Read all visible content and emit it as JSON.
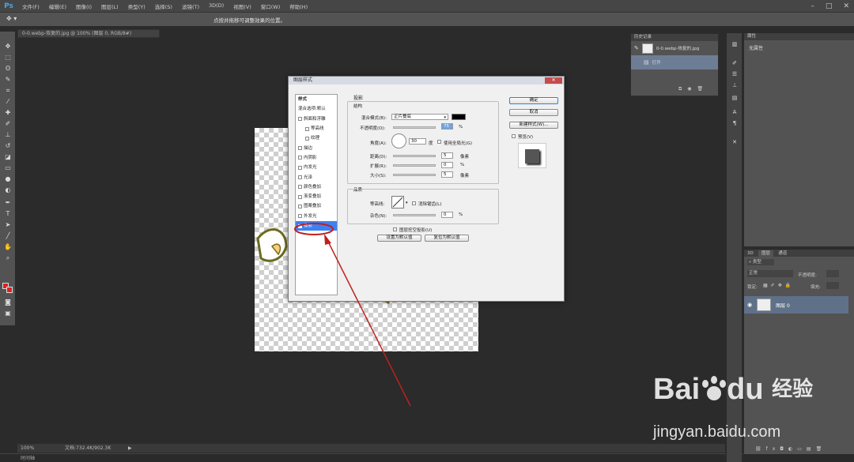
{
  "app": {
    "logo": "Ps"
  },
  "menu": [
    "文件(F)",
    "编辑(E)",
    "图像(I)",
    "图层(L)",
    "类型(Y)",
    "选择(S)",
    "滤镜(T)",
    "3D(D)",
    "视图(V)",
    "窗口(W)",
    "帮助(H)"
  ],
  "window_controls": [
    "–",
    "□",
    "✕"
  ],
  "options_bar": {
    "hint": "点按并拖移可调整效果的位置。"
  },
  "document": {
    "tab_title": "0-0.webp-恢复的.jpg @ 100% (图层 0, RGB/8#)"
  },
  "status": {
    "zoom": "100%",
    "doc_info": "文档:732.4K/902.3K",
    "bottom_label": "时间轴"
  },
  "history": {
    "tab": "历史记录",
    "items": [
      {
        "label": "0-0.webp-恢复的.jpg"
      },
      {
        "label": "打开"
      }
    ]
  },
  "properties": {
    "tab": "属性",
    "empty_text": "无属性"
  },
  "layers_panel": {
    "tabs": [
      "3D",
      "图层",
      "通道"
    ],
    "filter_label": "类型",
    "blend_mode": "正常",
    "opacity_label": "不透明度:",
    "lock_label": "锁定:",
    "fill_label": "填充:",
    "layer_name": "图层 0"
  },
  "dialog": {
    "title": "图层样式",
    "styles_header": "样式",
    "styles": [
      {
        "label": "混合选项:默认",
        "checkbox": false,
        "indent": false
      },
      {
        "label": "斜面和浮雕",
        "checkbox": true,
        "indent": false
      },
      {
        "label": "等高线",
        "checkbox": true,
        "indent": true
      },
      {
        "label": "纹理",
        "checkbox": true,
        "indent": true
      },
      {
        "label": "描边",
        "checkbox": true,
        "indent": false
      },
      {
        "label": "内阴影",
        "checkbox": true,
        "indent": false
      },
      {
        "label": "内发光",
        "checkbox": true,
        "indent": false
      },
      {
        "label": "光泽",
        "checkbox": true,
        "indent": false
      },
      {
        "label": "颜色叠加",
        "checkbox": true,
        "indent": false
      },
      {
        "label": "渐变叠加",
        "checkbox": true,
        "indent": false
      },
      {
        "label": "图案叠加",
        "checkbox": true,
        "indent": false
      },
      {
        "label": "外发光",
        "checkbox": true,
        "indent": false
      },
      {
        "label": "投影",
        "checkbox": true,
        "checked": true,
        "indent": false,
        "selected": true
      }
    ],
    "section_title": "投影",
    "structure_title": "结构",
    "blend_mode_label": "混合模式(B):",
    "blend_mode_value": "正片叠底",
    "shadow_color": "#000000",
    "opacity_label": "不透明度(O):",
    "opacity_value": "75",
    "percent": "%",
    "angle_label": "角度(A):",
    "angle_value": "30",
    "angle_unit": "度",
    "global_light_label": "使用全局光(G)",
    "distance_label": "距离(D):",
    "distance_value": "5",
    "pixel_unit": "像素",
    "spread_label": "扩展(R):",
    "spread_value": "0",
    "size_label": "大小(S):",
    "size_value": "5",
    "quality_title": "品质",
    "contour_label": "等高线:",
    "anti_alias_label": "消除锯齿(L)",
    "noise_label": "杂色(N):",
    "noise_value": "0",
    "knockout_label": "图层挖空投影(U)",
    "set_default_btn": "设置为默认值",
    "reset_default_btn": "复位为默认值",
    "ok_btn": "确定",
    "cancel_btn": "取消",
    "new_style_btn": "新建样式(W)...",
    "preview_label": "预览(V)"
  },
  "watermark": {
    "brand": "Bai",
    "brand2": "du",
    "cn": "经验",
    "url": "jingyan.baidu.com"
  },
  "colors": {
    "accent": "#3b82f6",
    "annotation": "#c0201c",
    "layer_highlight": "#5f7089"
  }
}
